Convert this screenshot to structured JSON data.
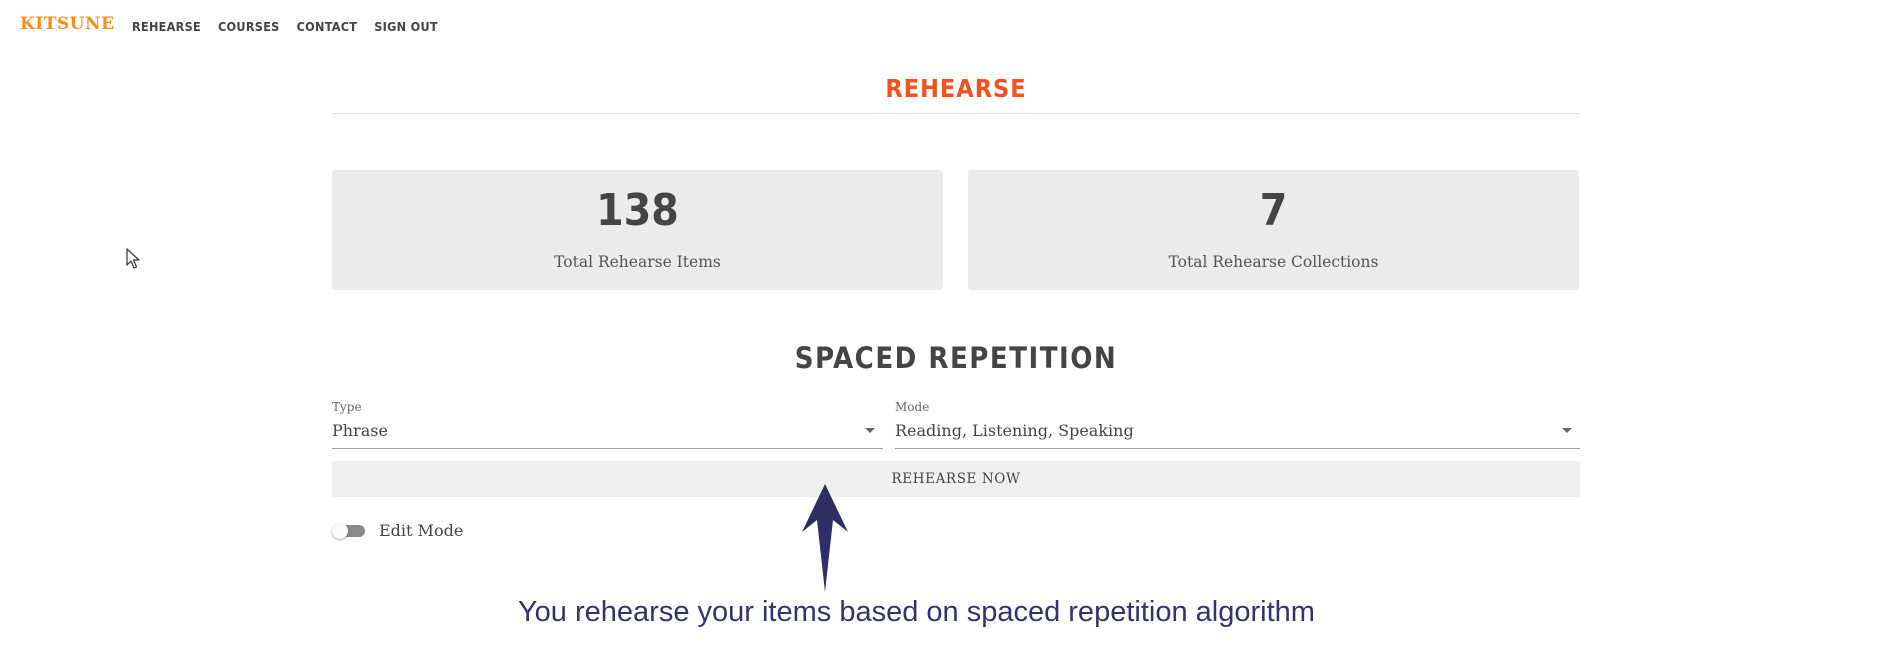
{
  "app": {
    "brand": "KITSUNE",
    "accent_color": "#ff8c1a",
    "heading_color": "#f4511e"
  },
  "nav": {
    "items": [
      {
        "label": "REHEARSE"
      },
      {
        "label": "COURSES"
      },
      {
        "label": "CONTACT"
      },
      {
        "label": "SIGN OUT"
      }
    ]
  },
  "page": {
    "title": "REHEARSE"
  },
  "stats": {
    "items": [
      {
        "value": "138",
        "label": "Total Rehearse Items"
      },
      {
        "value": "7",
        "label": "Total Rehearse Collections"
      }
    ]
  },
  "spaced_repetition": {
    "title": "SPACED REPETITION",
    "type_label": "Type",
    "type_value": "Phrase",
    "mode_label": "Mode",
    "mode_value": "Reading, Listening, Speaking",
    "button_label": "REHEARSE NOW",
    "edit_mode_label": "Edit Mode",
    "edit_mode_on": false
  },
  "annotation": {
    "text": "You rehearse your items based on spaced repetition algorithm",
    "color": "#33336e",
    "icon": "arrow-up-icon"
  },
  "cursor": {
    "icon": "mouse-pointer-icon"
  }
}
